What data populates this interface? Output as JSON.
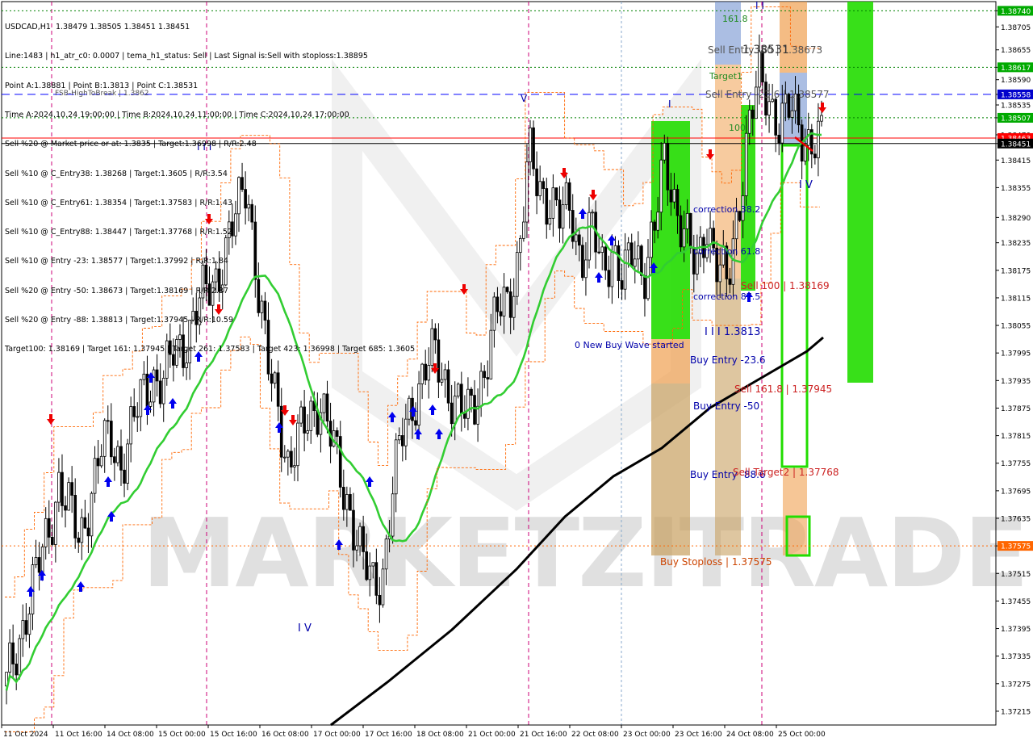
{
  "info_lines": [
    "USDCAD,H1  1.38479 1.38505 1.38451 1.38451",
    "Line:1483 | h1_atr_c0: 0.0007 | tema_h1_status: Sell | Last Signal is:Sell with stoploss:1.38895",
    "Point A:1.38881 | Point B:1.3813 | Point C:1.38531",
    "Time A:2024.10.24 19:00:00 | Time B:2024.10.24 11:00:00 | Time C:2024.10.24 17:00:00",
    "Sell %20 @ Market price or at: 1.3835 | Target:1.36998 | R/R:2.48",
    "Sell %10 @ C_Entry38: 1.38268 | Target:1.3605 | R/R:3.54",
    "Sell %10 @ C_Entry61: 1.38354 | Target:1.37583 | R/R:1.43",
    "Sell %10 @ C_Entry88: 1.38447 | Target:1.37768 | R/R:1.52",
    "Sell %10 @ Entry -23: 1.38577 | Target:1.37992 | R/R:1.84",
    "Sell %20 @ Entry -50: 1.38673 | Target:1.38169 | R/R:2.37",
    "Sell %20 @ Entry -88: 1.38813 | Target:1.37945 | R/R:10.59",
    "Target100: 1.38169 | Target 161: 1.37945 | Target 261: 1.37583 | Target 423: 1.36998 | Target 685: 1.3605"
  ],
  "watermark": "MARKETZITRADE",
  "colors": {
    "bull": "#000000",
    "bear": "#000000",
    "ma_green": "#32cd32",
    "ma_black": "#000000",
    "red_line": "#ff0000",
    "blue_dash": "#0000ff",
    "green_dot": "#008000",
    "orange_dot": "#ff6600",
    "zone_green": "#22dd00",
    "zone_orange": "#f0a050",
    "zone_tan": "#c8a060",
    "vline_magenta": "#cc0077"
  },
  "chart_data": {
    "type": "candlestick",
    "symbol": "USDCAD",
    "timeframe": "H1",
    "ohlc_current": {
      "open": 1.38479,
      "high": 1.38505,
      "low": 1.38451,
      "close": 1.38451
    },
    "ylim": [
      1.37185,
      1.3876
    ],
    "y_ticks": [
      "1.38740",
      "1.38705",
      "1.38655",
      "1.38617",
      "1.38590",
      "1.38558",
      "1.38535",
      "1.38507",
      "1.38470",
      "1.38451",
      "1.38415",
      "1.38355",
      "1.38290",
      "1.38235",
      "1.38175",
      "1.38115",
      "1.38055",
      "1.37995",
      "1.37935",
      "1.37875",
      "1.37815",
      "1.37755",
      "1.37695",
      "1.37635",
      "1.37575",
      "1.37515",
      "1.37455",
      "1.37395",
      "1.37335",
      "1.37275",
      "1.37215"
    ],
    "x_labels": [
      "11 Oct 2024",
      "11 Oct 16:00",
      "14 Oct 08:00",
      "15 Oct 00:00",
      "15 Oct 16:00",
      "16 Oct 08:00",
      "17 Oct 00:00",
      "17 Oct 16:00",
      "18 Oct 08:00",
      "21 Oct 00:00",
      "21 Oct 16:00",
      "22 Oct 08:00",
      "23 Oct 00:00",
      "23 Oct 16:00",
      "24 Oct 08:00",
      "25 Oct 00:00"
    ],
    "close_path": [
      1.3727,
      1.3735,
      1.3745,
      1.3752,
      1.376,
      1.3772,
      1.3765,
      1.3758,
      1.3769,
      1.3778,
      1.378,
      1.3776,
      1.3783,
      1.379,
      1.3795,
      1.3793,
      1.3799,
      1.3802,
      1.3808,
      1.3812,
      1.3816,
      1.3822,
      1.3829,
      1.3838,
      1.3815,
      1.3796,
      1.3788,
      1.3775,
      1.378,
      1.3786,
      1.379,
      1.3781,
      1.3772,
      1.3765,
      1.3754,
      1.3749,
      1.3752,
      1.377,
      1.3783,
      1.379,
      1.3795,
      1.3799,
      1.3794,
      1.3788,
      1.3785,
      1.3791,
      1.3798,
      1.3808,
      1.3812,
      1.382,
      1.3842,
      1.3836,
      1.3833,
      1.3828,
      1.3832,
      1.382,
      1.3826,
      1.3818,
      1.3823,
      1.3814,
      1.3822,
      1.3818,
      1.3826,
      1.3841,
      1.3833,
      1.3825,
      1.3816,
      1.3829,
      1.3819,
      1.3813,
      1.3831,
      1.3849,
      1.3858,
      1.3855,
      1.385,
      1.3852,
      1.3848,
      1.3846,
      1.3845
    ],
    "price_labels": [
      {
        "text": "1.38740",
        "value": 1.3874,
        "bg": "#00aa00"
      },
      {
        "text": "1.38617",
        "value": 1.38617,
        "bg": "#00aa00"
      },
      {
        "text": "1.38558",
        "value": 1.38558,
        "bg": "#0000cc"
      },
      {
        "text": "1.38507",
        "value": 1.38507,
        "bg": "#00aa00"
      },
      {
        "text": "1.38463",
        "value": 1.38463,
        "bg": "#ff0000"
      },
      {
        "text": "1.38451",
        "value": 1.38451,
        "bg": "#000000"
      },
      {
        "text": "1.37575",
        "value": 1.37575,
        "bg": "#ff6600"
      }
    ],
    "hlines": [
      {
        "value": 1.3874,
        "color": "#008000",
        "style": "dot"
      },
      {
        "value": 1.38617,
        "color": "#008000",
        "style": "dot"
      },
      {
        "value": 1.38558,
        "color": "#0000ff",
        "style": "dash"
      },
      {
        "value": 1.38507,
        "color": "#008000",
        "style": "dot"
      },
      {
        "value": 1.38463,
        "color": "#ff0000",
        "style": "solid"
      },
      {
        "value": 1.38451,
        "color": "#000000",
        "style": "solid"
      },
      {
        "value": 1.37575,
        "color": "#ff6600",
        "style": "dot"
      }
    ],
    "annotations": [
      {
        "text": "Sell Entry -50 | 1.38673",
        "color": "#555555"
      },
      {
        "text": "Target1",
        "color": "#228b22"
      },
      {
        "text": "Sell Entry -23.6 | 1.38577",
        "color": "#555555"
      },
      {
        "text": "100",
        "color": "#228b22"
      },
      {
        "text": "161.8",
        "color": "#228b22"
      },
      {
        "text": "1.38531",
        "color": "#333333"
      },
      {
        "text": "correction 38.2",
        "color": "#0000aa"
      },
      {
        "text": "correction 61.8",
        "color": "#0000aa"
      },
      {
        "text": "correction 87.5",
        "color": "#0000aa"
      },
      {
        "text": "Sell 100 | 1.38169",
        "color": "#cc2222"
      },
      {
        "text": "I I I  1.3813",
        "color": "#0000aa"
      },
      {
        "text": "0 New Buy Wave started",
        "color": "#0000aa"
      },
      {
        "text": "Buy Entry -23.6",
        "color": "#0000aa"
      },
      {
        "text": "Sell 161.8 | 1.37945",
        "color": "#cc2222"
      },
      {
        "text": "Buy Entry -50",
        "color": "#0000aa"
      },
      {
        "text": "Buy Entry -88.6",
        "color": "#0000aa"
      },
      {
        "text": "Sell Target2 | 1.37768",
        "color": "#cc2222"
      },
      {
        "text": "Buy Stoploss | 1.37575",
        "color": "#cc4400"
      },
      {
        "text": "FSB-HighToBreak | 1.3862",
        "color": "#555555"
      },
      {
        "text": "I V",
        "color": "#0000aa"
      },
      {
        "text": "I I I",
        "color": "#0000aa"
      },
      {
        "text": "V",
        "color": "#0000aa"
      },
      {
        "text": "I",
        "color": "#0000aa"
      },
      {
        "text": "I I",
        "color": "#0000aa"
      },
      {
        "text": "I V",
        "color": "#0000aa"
      }
    ]
  }
}
